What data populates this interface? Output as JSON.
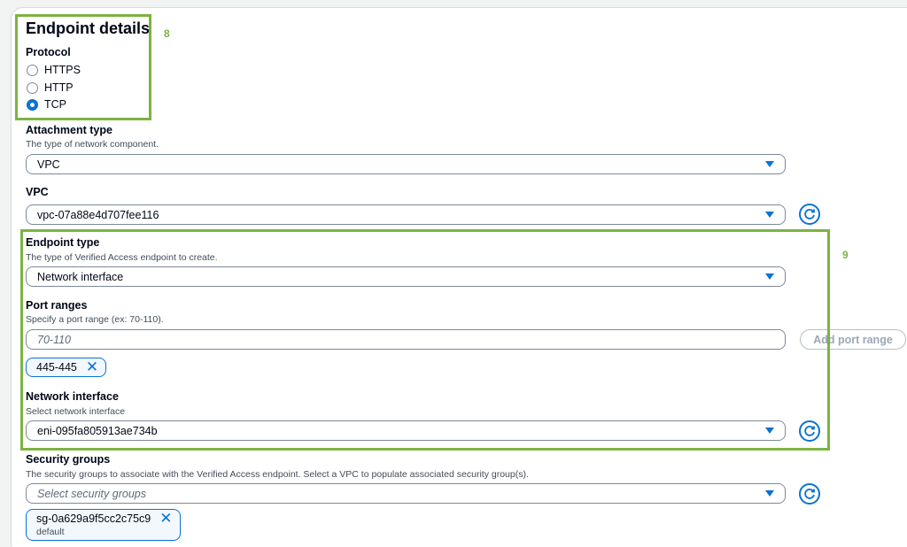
{
  "section": {
    "title": "Endpoint details"
  },
  "protocol": {
    "label": "Protocol",
    "options": [
      "HTTPS",
      "HTTP",
      "TCP"
    ],
    "selected": "TCP"
  },
  "attachment_type": {
    "label": "Attachment type",
    "description": "The type of network component.",
    "value": "VPC"
  },
  "vpc": {
    "label": "VPC",
    "value": "vpc-07a88e4d707fee116"
  },
  "endpoint_type": {
    "label": "Endpoint type",
    "description": "The type of Verified Access endpoint to create.",
    "value": "Network interface"
  },
  "port_ranges": {
    "label": "Port ranges",
    "description": "Specify a port range (ex: 70-110).",
    "placeholder": "70-110",
    "add_button": "Add port range",
    "tokens": [
      "445-445"
    ]
  },
  "network_interface": {
    "label": "Network interface",
    "description": "Select network interface",
    "value": "eni-095fa805913ae734b"
  },
  "security_groups": {
    "label": "Security groups",
    "description": "The security groups to associate with the Verified Access endpoint. Select a VPC to populate associated security group(s).",
    "placeholder": "Select security groups",
    "token": {
      "id": "sg-0a629a9f5cc2c75c9",
      "sub": "default"
    }
  },
  "annotations": {
    "box1": "8",
    "box2": "9"
  },
  "colors": {
    "accent": "#0972d3",
    "highlight": "#7cb342"
  }
}
